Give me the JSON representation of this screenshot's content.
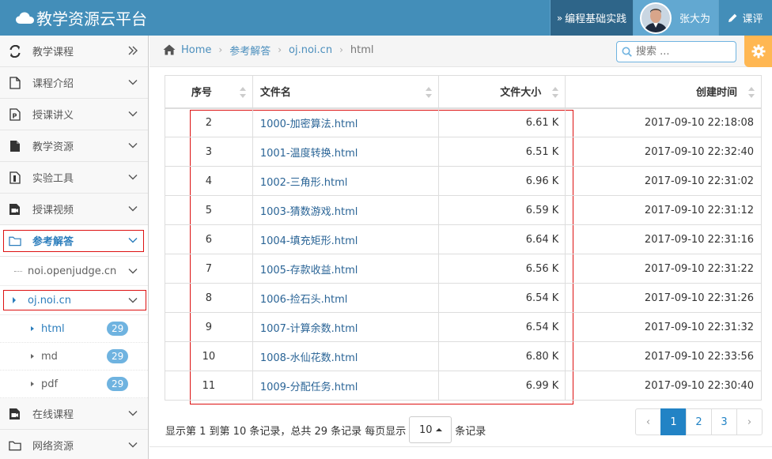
{
  "header": {
    "title": "教学资源云平台",
    "course_link": "编程基础实践",
    "user_name": "张大为",
    "review_label": "课评"
  },
  "sidebar": {
    "items": [
      {
        "label": "教学课程",
        "icon": "refresh-icon"
      },
      {
        "label": "课程介绍",
        "icon": "file-icon"
      },
      {
        "label": "授课讲义",
        "icon": "powerpoint-icon"
      },
      {
        "label": "教学资源",
        "icon": "file-solid-icon"
      },
      {
        "label": "实验工具",
        "icon": "flask-icon"
      },
      {
        "label": "授课视频",
        "icon": "video-icon"
      },
      {
        "label": "参考解答",
        "icon": "folder-icon"
      }
    ],
    "sub_items": [
      {
        "label": "noi.openjudge.cn"
      },
      {
        "label": "oj.noi.cn"
      }
    ],
    "subsub_items": [
      {
        "label": "html",
        "count": "29"
      },
      {
        "label": "md",
        "count": "29"
      },
      {
        "label": "pdf",
        "count": "29"
      }
    ],
    "bottom_items": [
      {
        "label": "在线课程",
        "icon": "video-icon"
      },
      {
        "label": "网络资源",
        "icon": "folder-icon"
      }
    ]
  },
  "breadcrumb": {
    "items": [
      "Home",
      "参考解答",
      "oj.noi.cn",
      "html"
    ]
  },
  "search": {
    "placeholder": "搜索 ..."
  },
  "table": {
    "headers": [
      "序号",
      "文件名",
      "文件大小",
      "创建时间"
    ],
    "rows": [
      [
        "2",
        "1000-加密算法.html",
        "6.61 K",
        "2017-09-10 22:18:08"
      ],
      [
        "3",
        "1001-温度转换.html",
        "6.51 K",
        "2017-09-10 22:32:40"
      ],
      [
        "4",
        "1002-三角形.html",
        "6.96 K",
        "2017-09-10 22:31:02"
      ],
      [
        "5",
        "1003-猜数游戏.html",
        "6.59 K",
        "2017-09-10 22:31:12"
      ],
      [
        "6",
        "1004-填充矩形.html",
        "6.64 K",
        "2017-09-10 22:31:16"
      ],
      [
        "7",
        "1005-存款收益.html",
        "6.56 K",
        "2017-09-10 22:31:22"
      ],
      [
        "8",
        "1006-捡石头.html",
        "6.54 K",
        "2017-09-10 22:31:26"
      ],
      [
        "9",
        "1007-计算余数.html",
        "6.54 K",
        "2017-09-10 22:31:32"
      ],
      [
        "10",
        "1008-水仙花数.html",
        "6.80 K",
        "2017-09-10 22:33:56"
      ],
      [
        "11",
        "1009-分配任务.html",
        "6.99 K",
        "2017-09-10 22:30:40"
      ]
    ]
  },
  "footer": {
    "info_prefix": "显示第 1 到第 10 条记录，总共 29 条记录 每页显示",
    "page_size": "10",
    "info_suffix": "条记录",
    "pages": [
      "‹",
      "1",
      "2",
      "3",
      "›"
    ]
  },
  "colors": {
    "header_bg": "#438eb9",
    "accent": "#2283c5",
    "highlight_border": "#dd1111"
  }
}
